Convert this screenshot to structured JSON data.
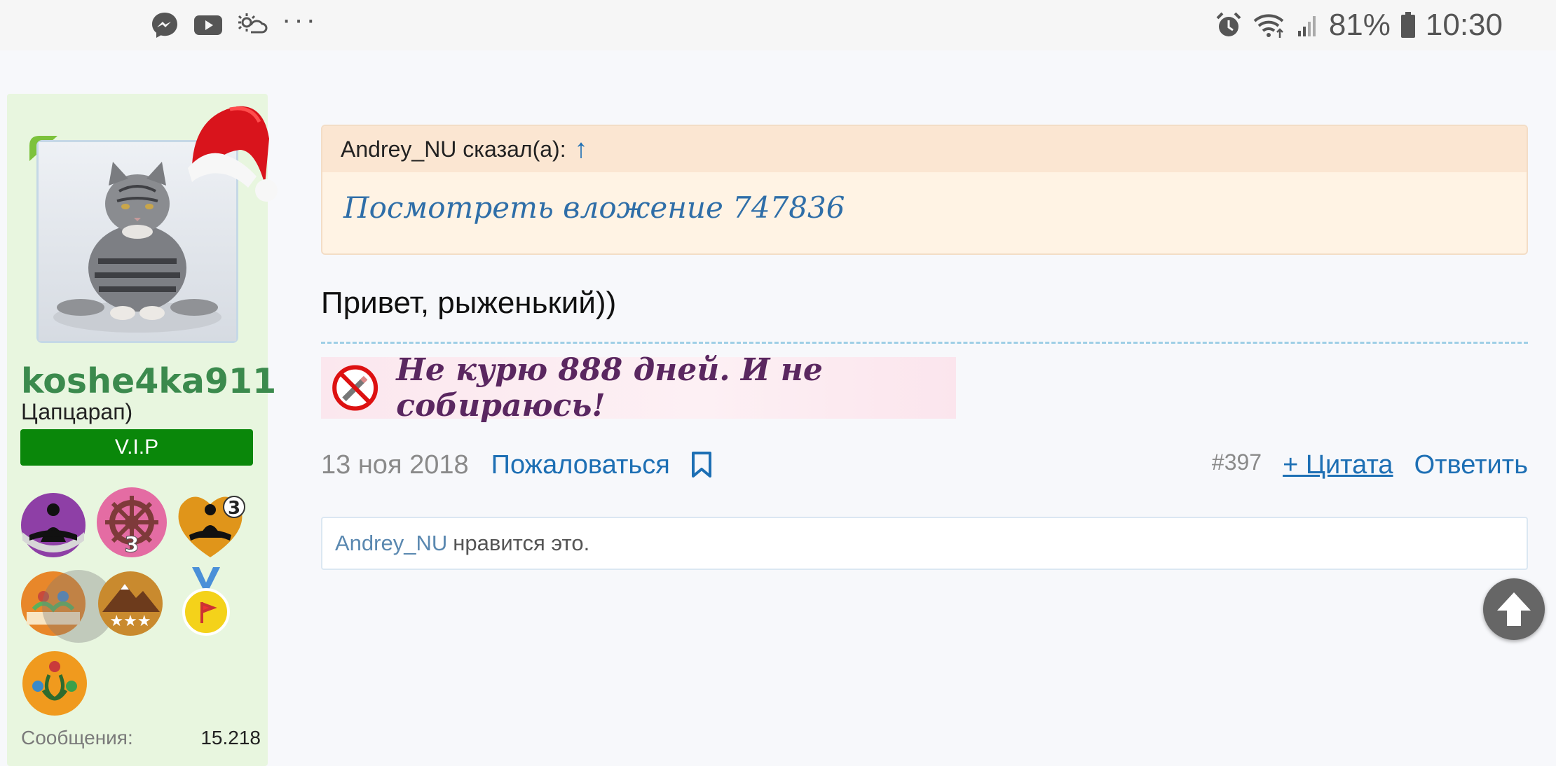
{
  "status_bar": {
    "notification_icons": [
      "messenger-icon",
      "youtube-icon",
      "weather-icon"
    ],
    "more": "···",
    "battery_percent": "81%",
    "time": "10:30"
  },
  "sidebar": {
    "username": "koshe4ka911",
    "user_title": "Цапцарап)",
    "badge": "V.I.P",
    "trophies": [
      {
        "name": "meditation-trophy"
      },
      {
        "name": "wheel-trophy",
        "level": "3"
      },
      {
        "name": "meditation-gold-trophy",
        "level": "3"
      },
      {
        "name": "people-trophy"
      },
      {
        "name": "mountain-stars-trophy"
      },
      {
        "name": "medal-trophy"
      },
      {
        "name": "community-trophy"
      }
    ],
    "stats": {
      "messages_label": "Сообщения:",
      "messages_value": "15.218"
    }
  },
  "post": {
    "quote": {
      "author_line": "Andrey_NU сказал(а):",
      "arrow": "↑",
      "attachment_text": "Посмотреть вложение 747836"
    },
    "message": "Привет, рыженький))",
    "signature": "Не курю 888 дней. И не собираюсь!",
    "footer": {
      "date": "13 ноя 2018",
      "report": "Пожаловаться",
      "post_number": "#397",
      "quote": "+ Цитата",
      "reply": "Ответить"
    },
    "likes": {
      "user": "Andrey_NU",
      "text": "нравится это."
    }
  },
  "colors": {
    "link": "#1d6fb4",
    "username": "#3b8a4d",
    "vip": "#0a870a",
    "sidebar_bg": "#e8f6df",
    "quote_bg": "#fff3e4"
  }
}
